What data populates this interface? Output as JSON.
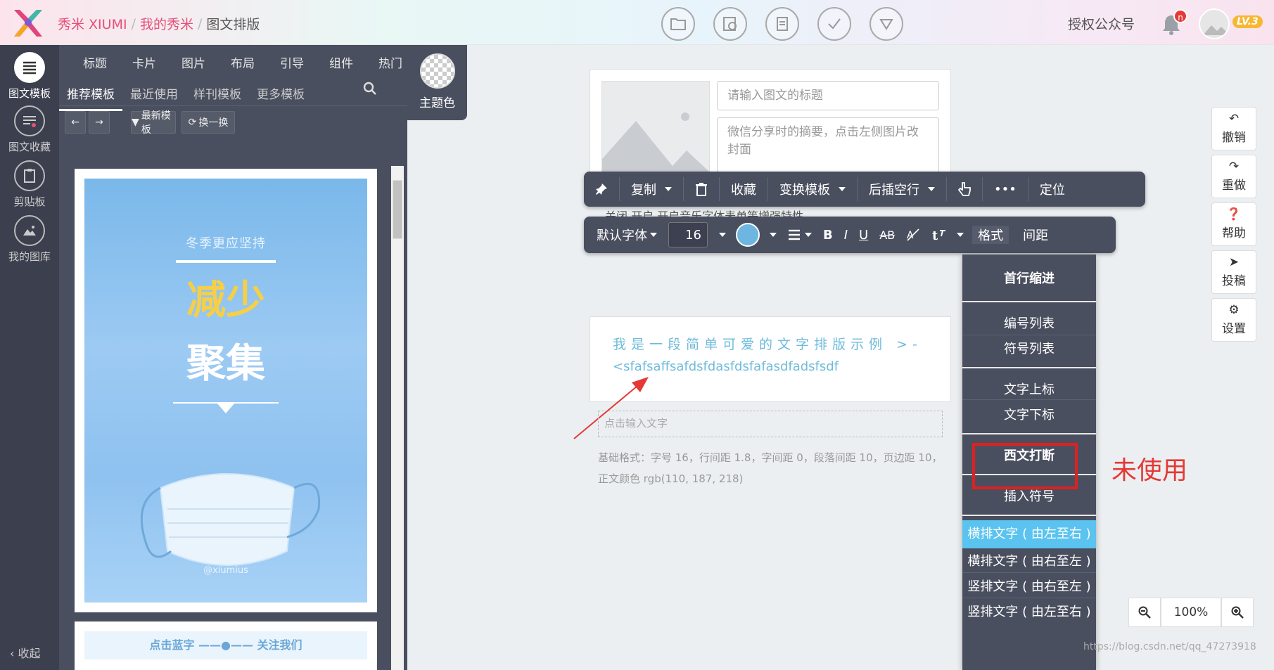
{
  "topbar": {
    "brand": "秀米 XIUMI",
    "crumb2": "我的秀米",
    "crumb3": "图文排版",
    "sep": "/",
    "tool_icons": [
      "folder-icon",
      "album-icon",
      "print-icon",
      "check-icon",
      "download-icon"
    ],
    "auth": "授权公众号",
    "notice_badge": "n",
    "level": "LV.3"
  },
  "rail": {
    "items": [
      {
        "label": "图文模板",
        "icon": "article-template-icon"
      },
      {
        "label": "图文收藏",
        "icon": "favorite-icon"
      },
      {
        "label": "剪贴板",
        "icon": "clipboard-icon"
      },
      {
        "label": "我的图库",
        "icon": "gallery-icon"
      }
    ],
    "collapse": "收起"
  },
  "panel": {
    "categories": [
      "标题",
      "卡片",
      "图片",
      "布局",
      "引导",
      "组件",
      "热门"
    ],
    "subtabs": [
      "推荐模板",
      "最近使用",
      "样刊模板",
      "更多模板"
    ],
    "newest": "最新模板",
    "shuffle": "换一换",
    "theme_label": "主题色"
  },
  "preview": {
    "subtitle": "冬季更应坚持",
    "line1": "减少",
    "line2": "聚集",
    "handle": "@xiumius",
    "follow": "点击蓝字 ——●—— 关注我们"
  },
  "editor": {
    "title_placeholder": "请输入图文的标题",
    "summary_placeholder": "微信分享时的摘要，点击左侧图片改封面",
    "peek": "关闭  开启  开启音乐字体表单等增强特性",
    "sample_line1": "我是一段简单可爱的文字排版示例 >-",
    "sample_line2": "<sfafsaffsafdsfdasfdsfafasdfadsfsdf",
    "input_placeholder": "点击输入文字",
    "basic_format": "基础格式：字号 16，行间距 1.8，字间距 0，段落间距 10，页边距 10，正文颜色 rgb(110, 187, 218)"
  },
  "toolbar1": {
    "copy": "复制",
    "collect": "收藏",
    "swap": "变换模板",
    "blank": "后插空行",
    "more": "•••",
    "locate": "定位"
  },
  "toolbar2": {
    "font": "默认字体",
    "size": "16",
    "format": "格式",
    "spacing": "间距",
    "strike": "AB",
    "bold": "B",
    "italic": "I",
    "underline": "U",
    "color": "#6cb6e1"
  },
  "dropdown": {
    "items": [
      "首行缩进",
      "编号列表",
      "符号列表",
      "文字上标",
      "文字下标",
      "西文打断",
      "插入符号",
      "横排文字 ( 由左至右 )",
      "横排文字 ( 由右至左 )",
      "竖排文字 ( 由右至左 )",
      "竖排文字 ( 由左至右 )"
    ],
    "selected_index": 7
  },
  "annotation": "未使用",
  "right_tools": [
    "撤销",
    "重做",
    "帮助",
    "投稿",
    "设置"
  ],
  "zoom": "100%",
  "watermark": "https://blog.csdn.net/qq_47273918"
}
